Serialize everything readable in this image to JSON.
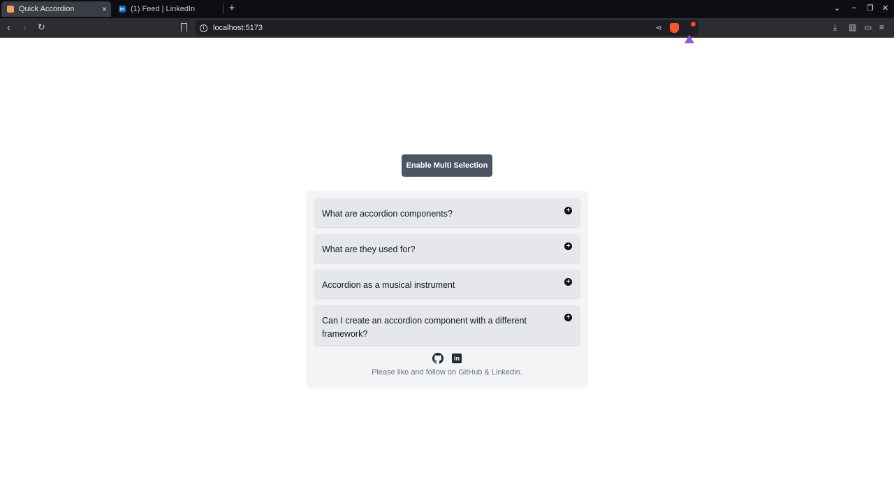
{
  "browser": {
    "tabs": [
      {
        "title": "Quick Accordion",
        "active": true
      },
      {
        "title": "(1) Feed | LinkedIn",
        "active": false
      }
    ],
    "url": "localhost:5173"
  },
  "page": {
    "multi_button_label": "Enable Multi Selection",
    "accordion_items": [
      {
        "question": "What are accordion components?"
      },
      {
        "question": "What are they used for?"
      },
      {
        "question": "Accordion as a musical instrument"
      },
      {
        "question": "Can I create an accordion component with a different framework?"
      }
    ],
    "footer_text": "Please like and follow on GitHub & Linkedin.",
    "icons": {
      "expand": "plus-circle-icon",
      "github": "github-icon",
      "linkedin": "linkedin-icon"
    }
  },
  "colors": {
    "button_bg": "#4b5563",
    "card_bg": "#f3f4f6",
    "item_bg": "#e5e7eb"
  }
}
